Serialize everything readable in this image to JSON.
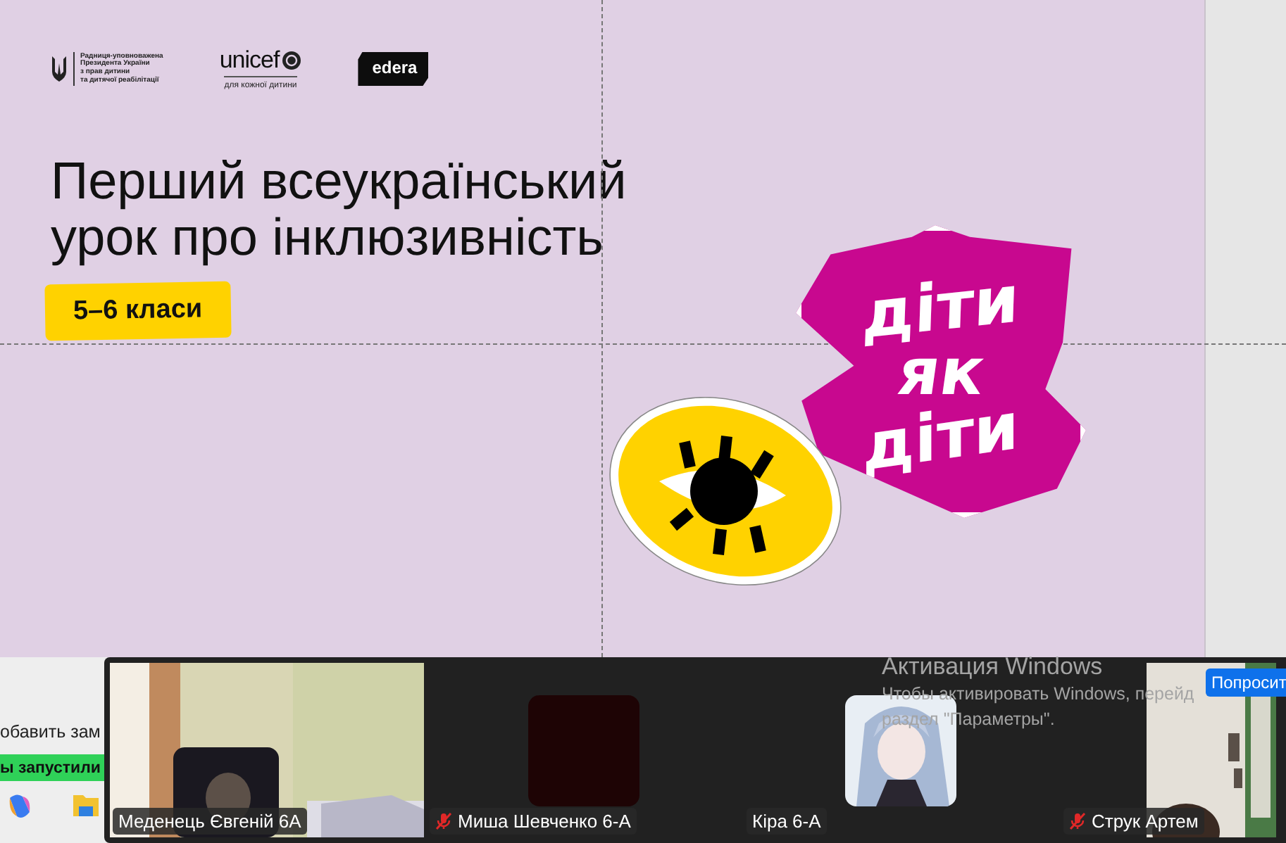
{
  "slide": {
    "org_logo_text": [
      "Радниця-уповноважена",
      "Президента України",
      "з прав дитини",
      "та дитячої реабілітації"
    ],
    "unicef": "unicef",
    "unicef_tagline": "для кожної дитини",
    "edera": "edera",
    "title_lines": [
      "Перший всеукраїнський",
      "урок про інклюзивність"
    ],
    "grade_badge": "5–6 класи",
    "sticker_words": [
      "діти",
      "як",
      "діти"
    ]
  },
  "background_window": {
    "text": "обавить зам",
    "banner": "ы запустили"
  },
  "video_call": {
    "participants": [
      {
        "name": "Меденець Євгеній 6А",
        "muted": false,
        "kind": "video"
      },
      {
        "name": "Миша Шевченко 6-А",
        "muted": true,
        "kind": "blank-avatar"
      },
      {
        "name": "Кіра 6-А",
        "muted": false,
        "kind": "picture-avatar"
      },
      {
        "name": "Струк Артем",
        "muted": true,
        "kind": "portrait-video"
      }
    ],
    "request_button": "Попросит"
  },
  "windows_activation": {
    "title": "Активация Windows",
    "lines": [
      "Чтобы активировать Windows, перейд",
      "раздел \"Параметры\"."
    ]
  }
}
